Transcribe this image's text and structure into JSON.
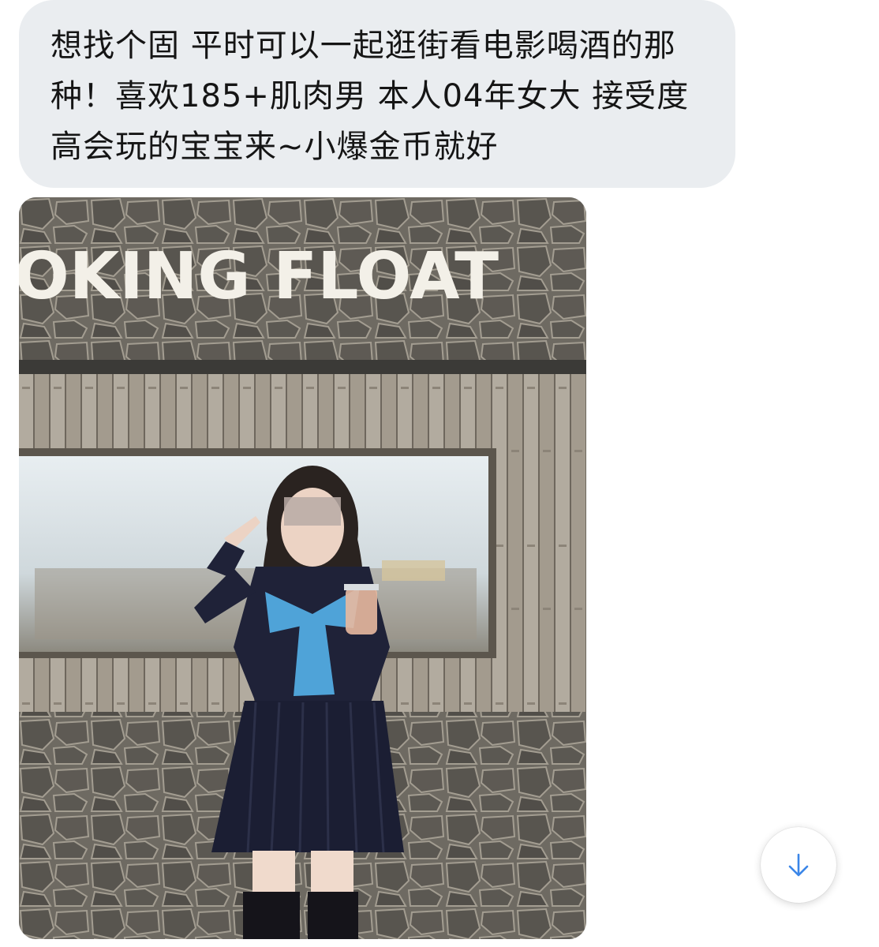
{
  "message": {
    "text": "想找个固 平时可以一起逛街看电影喝酒的那种！喜欢185+肌肉男 本人04年女大 接受度高会玩的宝宝来~小爆金币就好"
  },
  "photo": {
    "sign_text": "OKING FLOAT",
    "description_icon": "photo-attachment"
  },
  "scroll_button": {
    "icon": "arrow-down-icon",
    "accent": "#3b86e8"
  },
  "colors": {
    "bubble_bg": "#eaedf0",
    "text": "#151515"
  }
}
